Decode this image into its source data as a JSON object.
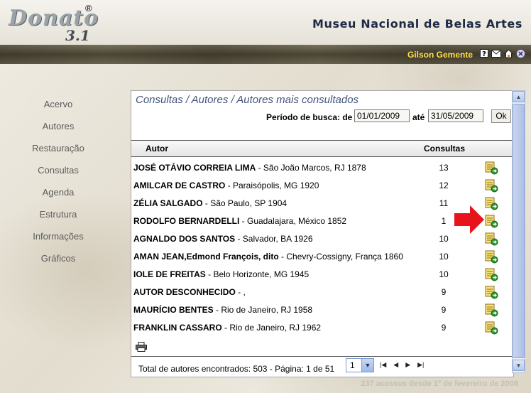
{
  "app": {
    "logo_text": "Donato",
    "logo_version": "3.1",
    "logo_reg": "®",
    "museum_title": "Museu Nacional de Belas Artes",
    "user_name": "Gilson Gemente"
  },
  "top_icons": [
    "help-icon",
    "mail-icon",
    "home-icon",
    "logout-icon"
  ],
  "sidebar": {
    "items": [
      {
        "label": "Acervo"
      },
      {
        "label": "Autores"
      },
      {
        "label": "Restauração"
      },
      {
        "label": "Consultas"
      },
      {
        "label": "Agenda"
      },
      {
        "label": "Estrutura"
      },
      {
        "label": "Informações"
      },
      {
        "label": "Gráficos"
      }
    ]
  },
  "main": {
    "breadcrumb": "Consultas / Autores / Autores mais consultados",
    "period_label": "Período de busca: de",
    "date_from": "01/01/2009",
    "ate_label": "até",
    "date_to": "31/05/2009",
    "ok_label": "Ok",
    "columns": {
      "autor": "Autor",
      "consultas": "Consultas"
    },
    "rows": [
      {
        "name": "JOSÉ OTÁVIO CORREIA LIMA",
        "info": " - São João Marcos, RJ 1878",
        "count": "13"
      },
      {
        "name": "AMILCAR DE CASTRO",
        "info": " - Paraisópolis, MG 1920",
        "count": "12"
      },
      {
        "name": "ZÉLIA SALGADO",
        "info": " - São Paulo, SP 1904",
        "count": "11"
      },
      {
        "name": "RODOLFO BERNARDELLI",
        "info": " - Guadalajara, México 1852",
        "count": "1"
      },
      {
        "name": "AGNALDO DOS SANTOS",
        "info": " - Salvador, BA 1926",
        "count": "10"
      },
      {
        "name": "AMAN JEAN,Edmond François, dito",
        "info": " - Chevry-Cossigny, França 1860",
        "count": "10"
      },
      {
        "name": "IOLE DE FREITAS",
        "info": " - Belo Horizonte, MG 1945",
        "count": "10"
      },
      {
        "name": "AUTOR DESCONHECIDO",
        "info": " - ,",
        "count": "9"
      },
      {
        "name": "MAURÍCIO BENTES",
        "info": " - Rio de Janeiro, RJ 1958",
        "count": "9"
      },
      {
        "name": "FRANKLIN CASSARO",
        "info": " - Rio de Janeiro, RJ 1962",
        "count": "9"
      }
    ],
    "total_text": "Total de autores encontrados: 503 - Página: 1 de 51",
    "page_value": "1",
    "pager_icons": [
      "first-page-icon",
      "prev-page-icon",
      "next-page-icon",
      "last-page-icon"
    ]
  },
  "footer": {
    "access_text": "237 acessos desde 1º de fevereiro de 2008"
  },
  "colors": {
    "user_name": "#ffe14a",
    "title": "#1e2a46",
    "breadcrumb": "#44557a",
    "arrow": "#e8141c"
  }
}
